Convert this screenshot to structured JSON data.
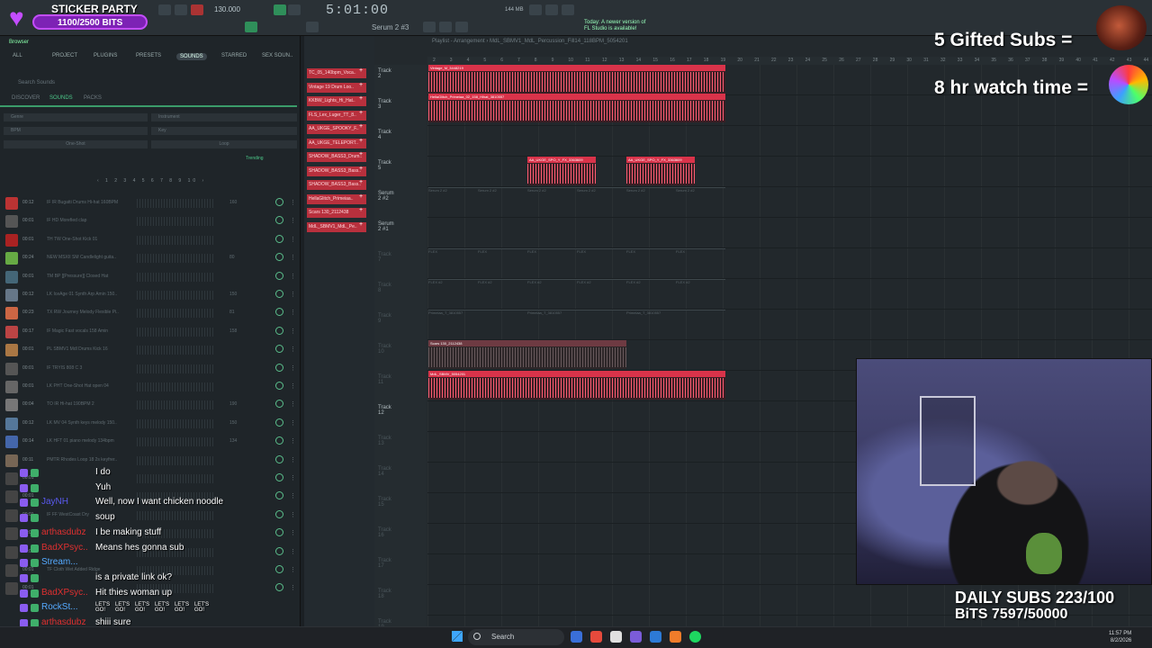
{
  "toolbar": {
    "tempo": "130.000",
    "time": "5:01:00",
    "cpu": "144 MB",
    "pattern": "Serum 2 #3",
    "hint": "Today: A newer version of FL Studio is available!"
  },
  "sticker": {
    "title": "STICKER PARTY",
    "progress": "1100/2500 BITS"
  },
  "browser": {
    "title": "Browser",
    "tabs": [
      "ALL",
      "PROJECT",
      "PLUGINS",
      "PRESETS",
      "SOUNDS",
      "STARRED",
      "SEX SOUN.."
    ],
    "search_placeholder": "Search Sounds",
    "sub_tabs": [
      "DISCOVER",
      "SOUNDS",
      "PACKS"
    ],
    "filters": [
      "Genre",
      "Instrument",
      "BPM",
      "Key",
      "One-Shot",
      "Loop"
    ],
    "sort": "Trending",
    "pager": "‹ 1 2 3 4 5 6 7 8 9 10 ›",
    "sounds": [
      {
        "dur": "00:12",
        "name": "IF IR Bugatti Drums Hi-hat 160BPM",
        "bpm": "160",
        "color": "#b33"
      },
      {
        "dur": "00:01",
        "name": "IF HD Morefied clap",
        "bpm": "",
        "color": "#555"
      },
      {
        "dur": "00:01",
        "name": "TH TW One-Shot Kick 01",
        "bpm": "",
        "color": "#a22"
      },
      {
        "dur": "00:24",
        "name": "NEW MSXII SM Candlelight guita..",
        "bpm": "80",
        "color": "#6a4"
      },
      {
        "dur": "00:01",
        "name": "TM BP [[Pressure]] Closed Hat",
        "bpm": "",
        "color": "#467"
      },
      {
        "dur": "00:12",
        "name": "LK IceAge 01 Synth Arp Amin 150..",
        "bpm": "150",
        "color": "#678"
      },
      {
        "dur": "00:23",
        "name": "TX RW Journey Melody Flexible Pi..",
        "bpm": "81",
        "color": "#c64"
      },
      {
        "dur": "00:17",
        "name": "IF Magic Fast vocals 158 Amin",
        "bpm": "158",
        "color": "#b44"
      },
      {
        "dur": "00:01",
        "name": "PL SBMV1 Mdl Drums Kick 16",
        "bpm": "",
        "color": "#a74"
      },
      {
        "dur": "00:01",
        "name": "IF TRYIS 808 C 3",
        "bpm": "",
        "color": "#555"
      },
      {
        "dur": "00:01",
        "name": "LK PHT One-Shot Hat open 04",
        "bpm": "",
        "color": "#666"
      },
      {
        "dur": "00:04",
        "name": "TO IR Hi-hat 190BPM 2",
        "bpm": "190",
        "color": "#777"
      },
      {
        "dur": "00:12",
        "name": "LK MV 04 Synth keys melody 150..",
        "bpm": "150",
        "color": "#579"
      },
      {
        "dur": "00:14",
        "name": "LK HFT 01 piano melody 134bpm",
        "bpm": "134",
        "color": "#46a"
      },
      {
        "dur": "00:11",
        "name": "PMTR Rhodes Loop 18 2s keyfrer..",
        "bpm": "",
        "color": "#765"
      },
      {
        "dur": "00:01",
        "name": "",
        "bpm": "",
        "color": "#444"
      },
      {
        "dur": "00:01",
        "name": "",
        "bpm": "",
        "color": "#444"
      },
      {
        "dur": "00:01",
        "name": "IF FF WestCoast Dry",
        "bpm": "",
        "color": "#444"
      },
      {
        "dur": "00:01",
        "name": "",
        "bpm": "",
        "color": "#444"
      },
      {
        "dur": "00:01",
        "name": "",
        "bpm": "",
        "color": "#444"
      },
      {
        "dur": "00:01",
        "name": "TF Cloth Wet Added Ridge",
        "bpm": "",
        "color": "#444"
      },
      {
        "dur": "00:01",
        "name": "",
        "bpm": "",
        "color": "#444"
      }
    ]
  },
  "chat": [
    {
      "user": "",
      "user_color": "#e03030",
      "text": "I do"
    },
    {
      "user": "",
      "user_color": "#e03030",
      "text": "Yuh"
    },
    {
      "user": "JayNH",
      "user_color": "#5a5af0",
      "text": "Well, now I want chicken noodle"
    },
    {
      "user": "",
      "user_color": "#5a5af0",
      "text": "soup"
    },
    {
      "user": "arthasdubz",
      "user_color": "#e03030",
      "text": "I be making stuff"
    },
    {
      "user": "BadXPsyc..",
      "user_color": "#e03030",
      "text": "Means hes gonna sub"
    },
    {
      "user": "Stream...",
      "user_color": "#55aaff",
      "text": ""
    },
    {
      "user": "",
      "user_color": "#e03030",
      "text": "is a private link ok?"
    },
    {
      "user": "BadXPsyc..",
      "user_color": "#e03030",
      "text": "Hit thies woman up"
    },
    {
      "user": "RockSt...",
      "user_color": "#55aaff",
      "text": ""
    },
    {
      "user": "arthasdubz",
      "user_color": "#e03030",
      "text": "shiii sure"
    }
  ],
  "chat_emote": "LET'S GO!",
  "channels": [
    "TC_05_140bpm_Voca..",
    "Vintage 19 Drum Loo..",
    "KKBW_Lights_Hi_Hat..",
    "FLS_Lex_Luger_TT_8..",
    "AA_UKGE_SPOOKY_F..",
    "AA_UKGE_TELEPORT..",
    "SHADOW_BASS3_Drum..",
    "SHADOW_BASS3_Bass..",
    "SHADOW_BASS3_Bass..",
    "HellaGlitch_Primeiaa..",
    "Scars 130_2112438",
    "MdL_SBMV1_MdL_Pe.."
  ],
  "playlist": {
    "title": "Playlist - Arrangement › MdL_SBMV1_MdL_Percussion_Fill14_118BPM_5054201",
    "ruler": [
      "2",
      "3",
      "4",
      "5",
      "6",
      "7",
      "8",
      "9",
      "10",
      "11",
      "12",
      "13",
      "14",
      "15",
      "16",
      "17",
      "18",
      "19",
      "20",
      "21",
      "22",
      "23",
      "24",
      "25",
      "26",
      "27",
      "28",
      "29",
      "30",
      "31",
      "32",
      "33",
      "34",
      "35",
      "36",
      "37",
      "38",
      "39",
      "40",
      "41",
      "42",
      "43",
      "44"
    ],
    "tracks": [
      "Track 2",
      "Track 3",
      "Track 4",
      "Track 5",
      "Serum 2 #2",
      "Serum 2 #1",
      "Track 7",
      "Track 8",
      "Track 9",
      "Track 10",
      "Track 11",
      "Track 12",
      "Track 13",
      "Track 14",
      "Track 15",
      "Track 16",
      "Track 17",
      "Track 18",
      "Track 19"
    ],
    "clip_labels": {
      "vintage": "Vintage_M_3448219",
      "hella": "HellaGlitch_Primeiaa_02_158_Hihat_3810557",
      "ukge": "AA_UKGE_SPO_Y_FX_3363609",
      "serum": "Serum 2 #2",
      "flex": "FLEX",
      "flex2": "FLEX #2",
      "primeiaa": "Primeiaa_T_3810557",
      "scars": "Scars 130_2112438",
      "mdl": "MdL_SBMV_5054201"
    }
  },
  "overlay": {
    "goal1": "5 Gifted Subs =",
    "goal2": "8 hr watch time =",
    "daily_subs": "DAILY SUBS 223/100",
    "daily_bits": "BiTS 7597/50000"
  },
  "taskbar": {
    "search": "Search",
    "time": "11:57 PM",
    "date": "8/2/2026"
  },
  "colors": {
    "accent": "#3b9c6a",
    "clip": "#d9334a",
    "channel": "#b8303d",
    "sticker": "#7d22b5"
  }
}
